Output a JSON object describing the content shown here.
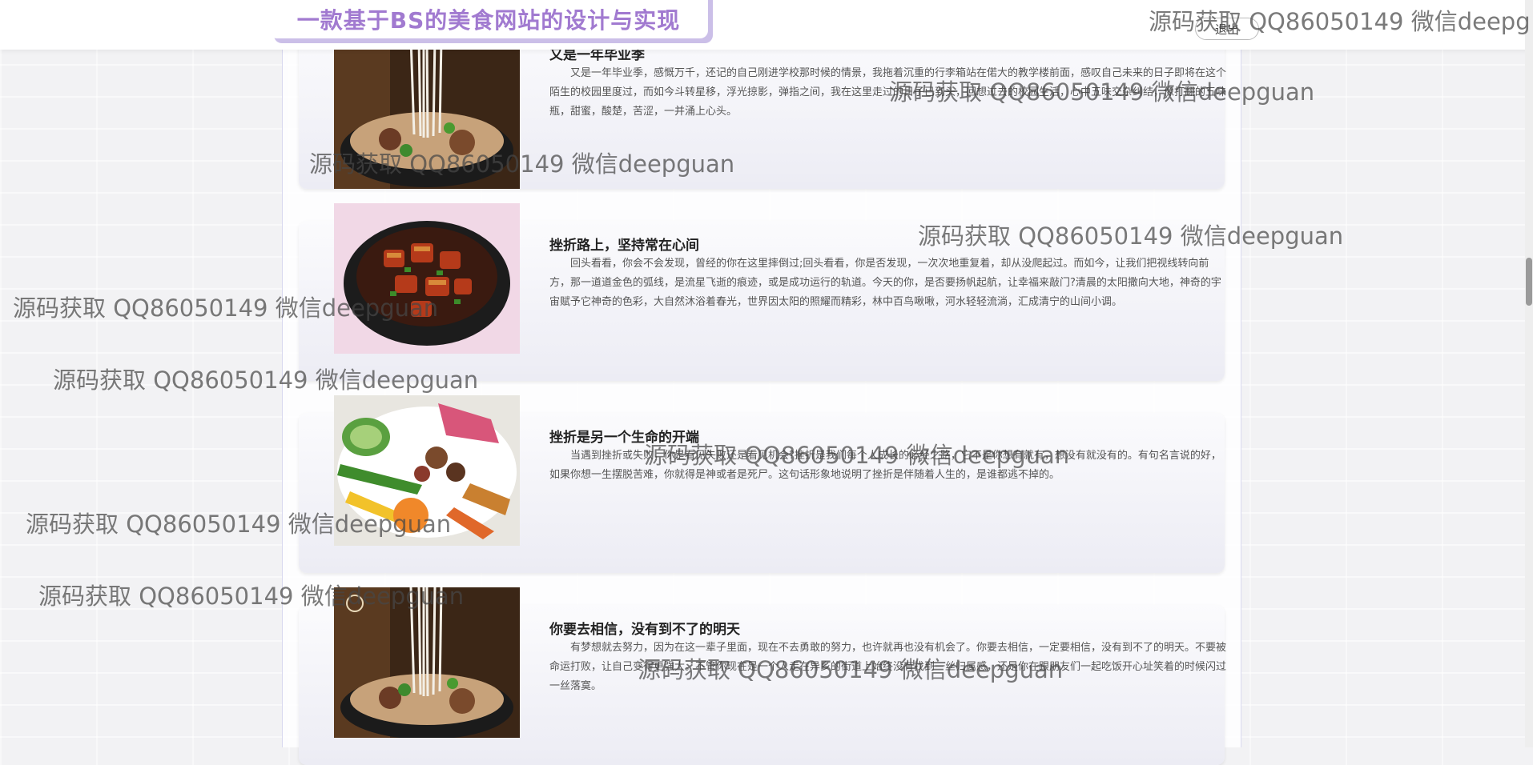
{
  "header": {
    "site_title": "一款基于BS的美食网站的设计与实现",
    "logout_label": "退出"
  },
  "articles": [
    {
      "title": "又是一年毕业季",
      "body": "又是一年毕业季，感慨万千，还记的自己刚进学校那时候的情景，我拖着沉重的行李箱站在偌大的教学楼前面，感叹自己未来的日子即将在这个陌生的校园里度过，而如今斗转星移，浮光掠影，弹指之间，我在这里走过的日子已到头，回想过去的校园生活，心中五味交杂纠结，像打翻的五味瓶，甜蜜，酸楚，苦涩，一并涌上心头。",
      "image": "noodle-bowl"
    },
    {
      "title": "挫折路上，坚持常在心间",
      "body": "回头看看，你会不会发现，曾经的你在这里摔倒过;回头看看，你是否发现，一次次地重复着，却从没爬起过。而如今，让我们把视线转向前方，那一道道金色的弧线，是流星飞逝的痕迹，或是成功运行的轨道。今天的你，是否要扬帆起航，让幸福来敲门?清晨的太阳撒向大地，神奇的宇宙赋予它神奇的色彩，大自然沐浴着春光，世界因太阳的照耀而精彩，林中百鸟啾啾，河水轻轻流淌，汇成清宁的山间小调。",
      "image": "braised-pork-pot"
    },
    {
      "title": "挫折是另一个生命的开端",
      "body": "当遇到挫折或失败，你是看见失败还是看见机会?挫折是我们每个人成长的必经之路，它不是你想有就有，想没有就没有的。有句名言说的好，如果你想一生摆脱苦难，你就得是神或者是死尸。这句话形象地说明了挫折是伴随着人生的，是谁都逃不掉的。",
      "image": "vegetable-plate"
    },
    {
      "title": "你要去相信，没有到不了的明天",
      "body": "有梦想就去努力，因为在这一辈子里面，现在不去勇敢的努力，也许就再也没有机会了。你要去相信，一定要相信，没有到不了的明天。不要被命运打败，让自己变得更强大。不管你现在是一个人走在异乡的街道上始终没有找到一丝归属感，还是你在跟朋友们一起吃饭开心址笑着的时候闪过一丝落寞。",
      "image": "noodle-bowl"
    }
  ],
  "watermark_text": "源码获取 QQ86050149 微信deepguan",
  "watermark_text_clipped": "源码获取 QQ86050149 微信deepg",
  "colors": {
    "title_purple": "#a17ad0",
    "tab_shadow": "#cbbfe8"
  }
}
